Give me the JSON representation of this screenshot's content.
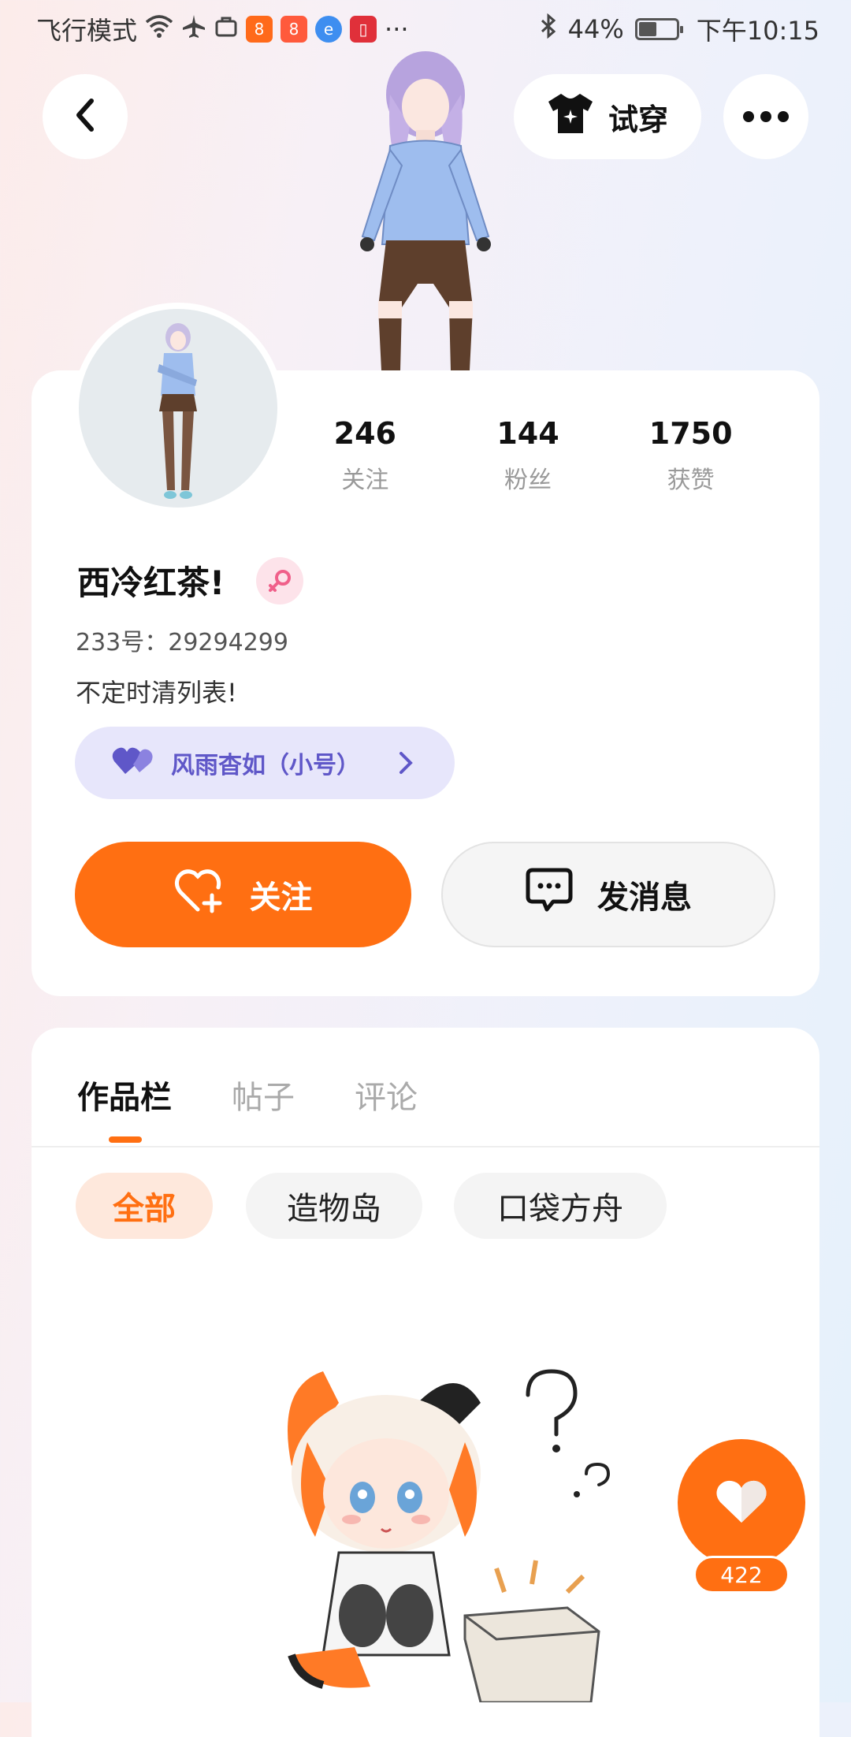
{
  "status_bar": {
    "left_text": "飞行模式",
    "more": "···",
    "battery": "44%",
    "time": "下午10:15"
  },
  "header": {
    "try_on_label": "试穿"
  },
  "profile": {
    "stats": [
      {
        "value": "246",
        "label": "关注"
      },
      {
        "value": "144",
        "label": "粉丝"
      },
      {
        "value": "1750",
        "label": "获赞"
      }
    ],
    "name": "西冷红茶!",
    "uid": "233号：29294299",
    "bio": "不定时清列表!",
    "linked_account": "风雨杳如（小号）",
    "follow_label": "关注",
    "message_label": "发消息"
  },
  "works": {
    "tabs": [
      "作品栏",
      "帖子",
      "评论"
    ],
    "filters": [
      "全部",
      "造物岛",
      "口袋方舟"
    ]
  },
  "like": {
    "count": "422"
  },
  "colors": {
    "accent": "#ff6f12",
    "linked_bg": "#e7e6fb",
    "linked_text": "#5f57c8"
  }
}
